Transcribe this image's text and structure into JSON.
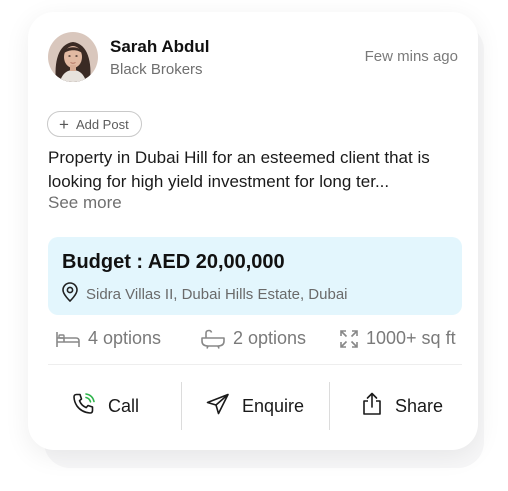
{
  "post": {
    "author_name": "Sarah Abdul",
    "company": "Black Brokers",
    "time": "Few mins ago",
    "add_post_label": "Add Post",
    "description": "Property in Dubai Hill for an esteemed client  that is looking for high yield investment for long ter...",
    "see_more": "See more"
  },
  "budget": {
    "text": "Budget : AED 20,00,000",
    "location": "Sidra Villas II, Dubai Hills Estate, Dubai",
    "background": "#e3f6fd"
  },
  "features": [
    {
      "icon": "bed-icon",
      "label": "4 options"
    },
    {
      "icon": "bath-icon",
      "label": "2 options"
    },
    {
      "icon": "area-expand-icon",
      "label": "1000+ sq ft"
    }
  ],
  "actions": {
    "call": "Call",
    "enquire": "Enquire",
    "share": "Share"
  },
  "colors": {
    "call_accent": "#2db34a",
    "budget_bg": "#e3f6fd"
  }
}
